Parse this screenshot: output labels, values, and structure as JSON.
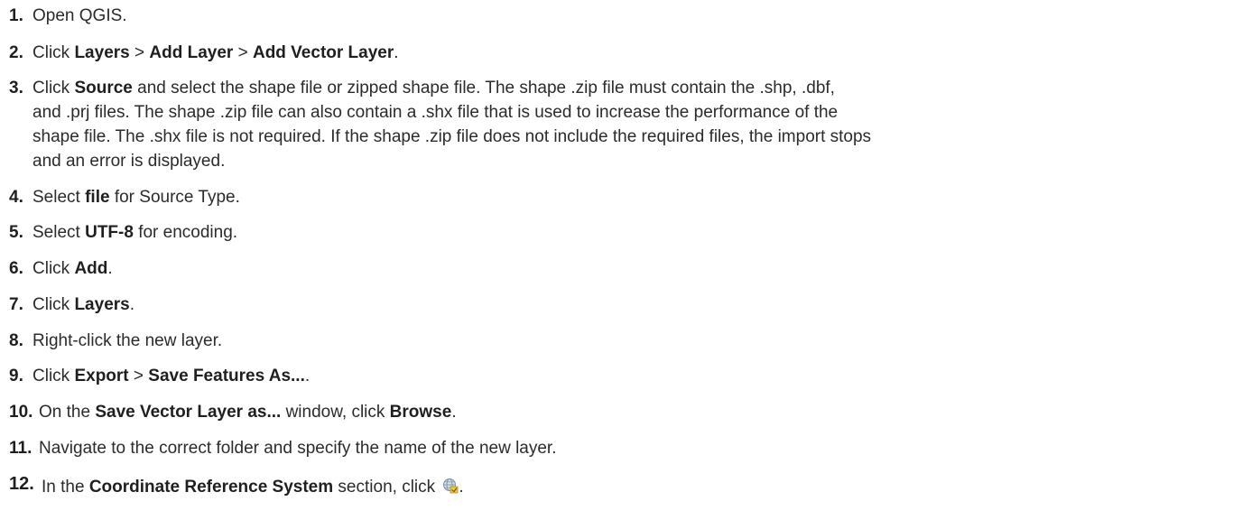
{
  "steps": [
    {
      "num": "1.",
      "parts": [
        "Open QGIS."
      ]
    },
    {
      "num": "2.",
      "parts": [
        "Click ",
        "Layers",
        " > ",
        "Add Layer",
        " > ",
        "Add Vector Layer",
        "."
      ]
    },
    {
      "num": "3.",
      "parts": [
        "Click ",
        "Source",
        " and select the shape file or zipped shape file. The shape .zip file must contain the .shp, .dbf,",
        "and .prj files. The shape .zip file can also contain a .shx file that is used to increase the performance of the",
        "shape file. The .shx file is not required. If the shape .zip file does not include the required files, the import stops",
        "and an error is displayed."
      ]
    },
    {
      "num": "4.",
      "parts": [
        "Select ",
        "file",
        " for Source Type."
      ]
    },
    {
      "num": "5.",
      "parts": [
        "Select ",
        "UTF-8",
        " for encoding."
      ]
    },
    {
      "num": "6.",
      "parts": [
        "Click ",
        "Add",
        "."
      ]
    },
    {
      "num": "7.",
      "parts": [
        "Click ",
        "Layers",
        "."
      ]
    },
    {
      "num": "8.",
      "parts": [
        "Right-click the new layer."
      ]
    },
    {
      "num": "9.",
      "parts": [
        "Click ",
        "Export",
        " > ",
        "Save Features As...",
        "."
      ]
    },
    {
      "num": "10.",
      "parts": [
        "On the ",
        "Save Vector Layer as...",
        " window, click ",
        "Browse",
        "."
      ]
    },
    {
      "num": "11.",
      "parts": [
        "Navigate to the correct folder and specify the name of the new layer."
      ]
    },
    {
      "num": "12.",
      "parts": [
        "In the ",
        "Coordinate Reference System",
        " section, click ",
        "."
      ]
    }
  ],
  "icons": {
    "crs": "globe-crs-icon"
  }
}
